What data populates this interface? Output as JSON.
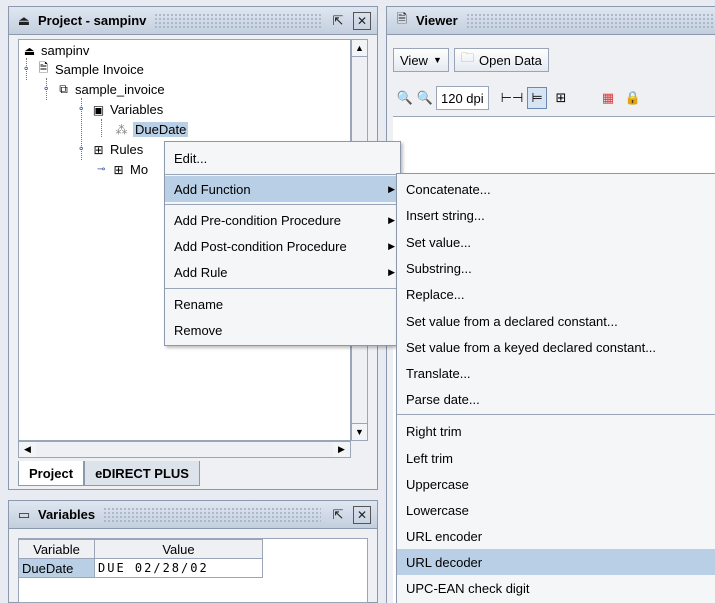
{
  "project_panel": {
    "title": "Project - sampinv",
    "tree": {
      "root": "sampinv",
      "invoice": "Sample Invoice",
      "doc": "sample_invoice",
      "variables": "Variables",
      "var_item": "DueDate",
      "rules": "Rules",
      "rules_child": "Mo"
    },
    "tabs": [
      "Project",
      "eDIRECT PLUS"
    ]
  },
  "variables_panel": {
    "title": "Variables",
    "columns": [
      "Variable",
      "Value"
    ],
    "rows": [
      {
        "variable": "DueDate",
        "value": "DUE 02/28/02"
      }
    ]
  },
  "viewer_panel": {
    "title": "Viewer",
    "view_button": "View",
    "open_data_button": "Open Data",
    "dpi_value": "120 dpi"
  },
  "context_menu": {
    "items": [
      "Edit...",
      "Add Function",
      "Add Pre-condition Procedure",
      "Add Post-condition Procedure",
      "Add Rule",
      "Rename",
      "Remove"
    ],
    "highlighted": "Add Function"
  },
  "function_submenu": {
    "items": [
      "Concatenate...",
      "Insert string...",
      "Set value...",
      "Substring...",
      "Replace...",
      "Set value from a declared constant...",
      "Set value from a keyed declared constant...",
      "Translate...",
      "Parse date...",
      "Right trim",
      "Left trim",
      "Uppercase",
      "Lowercase",
      "URL encoder",
      "URL decoder",
      "UPC-EAN check digit"
    ],
    "highlighted": "URL decoder"
  },
  "colors": {
    "selection": "#b8cfe5",
    "title_gradient_top": "#dfe6f0",
    "title_gradient_bottom": "#c4cfde"
  }
}
